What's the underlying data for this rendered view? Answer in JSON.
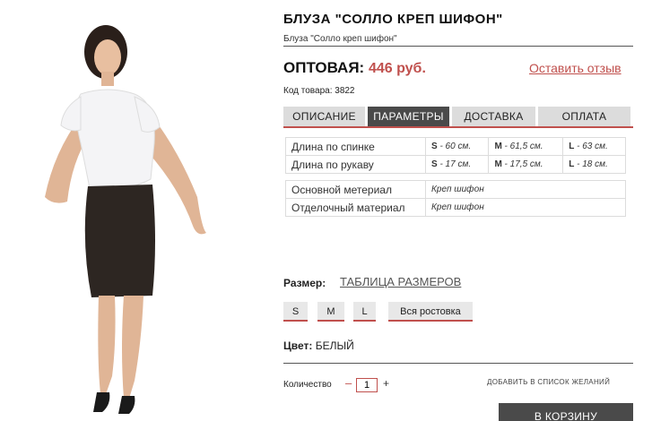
{
  "product": {
    "title": "БЛУЗА \"СОЛЛО КРЕП ШИФОН\"",
    "subtitle": "Блуза \"Солло креп шифон\"",
    "price_label": "ОПТОВАЯ:",
    "price_value": "446 руб.",
    "review_link": "Оставить отзыв",
    "sku": "Код товара: 3822"
  },
  "tabs": [
    {
      "label": "ОПИСАНИЕ",
      "active": false
    },
    {
      "label": "ПАРАМЕТРЫ",
      "active": true
    },
    {
      "label": "ДОСТАВКА",
      "active": false
    },
    {
      "label": "ОПЛАТА",
      "active": false
    }
  ],
  "params": {
    "rows": [
      {
        "label": "Длина по спинке",
        "s_key": "S",
        "s_val": " - 60 см.",
        "m_key": "M",
        "m_val": " - 61,5 см.",
        "l_key": "L",
        "l_val": " - 63 см."
      },
      {
        "label": "Длина по рукаву",
        "s_key": "S",
        "s_val": " - 17 см.",
        "m_key": "M",
        "m_val": " - 17,5 см.",
        "l_key": "L",
        "l_val": " - 18 см."
      }
    ],
    "materials": [
      {
        "label": "Основной метериал",
        "value": "Креп шифон"
      },
      {
        "label": "Отделочный материал",
        "value": "Креп шифон"
      }
    ]
  },
  "sizes": {
    "label": "Размер:",
    "table_link": "ТАБЛИЦА РАЗМЕРОВ",
    "options": [
      "S",
      "M",
      "L",
      "Вся ростовка"
    ]
  },
  "color": {
    "label": "Цвет:",
    "value": "БЕЛЫЙ"
  },
  "quantity": {
    "label": "Количество",
    "minus": "–",
    "value": "1",
    "plus": "+"
  },
  "wishlist": "ДОБАВИТЬ В СПИСОК ЖЕЛАНИЙ",
  "cart_button": "В КОРЗИНУ",
  "colors": {
    "accent": "#c0504d",
    "tab_active": "#4a4a4a",
    "tab_inactive": "#dcdcdc"
  }
}
